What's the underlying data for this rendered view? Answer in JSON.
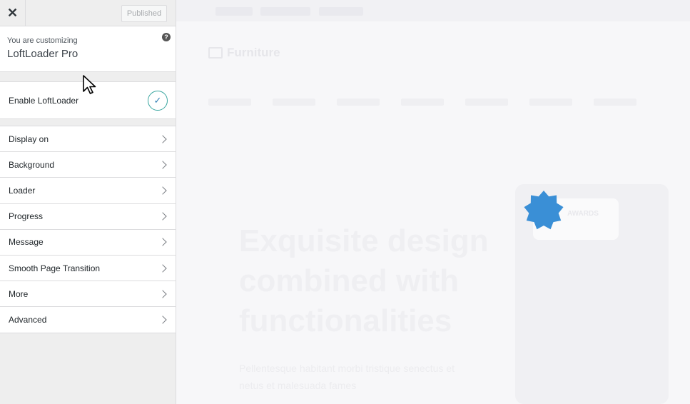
{
  "topbar": {
    "close_symbol": "✕",
    "published_label": "Published"
  },
  "info": {
    "subtitle": "You are customizing",
    "title": "LoftLoader Pro",
    "help_symbol": "?"
  },
  "enable": {
    "label": "Enable LoftLoader",
    "checked": true,
    "check_symbol": "✓"
  },
  "menu": {
    "items": [
      {
        "label": "Display on"
      },
      {
        "label": "Background"
      },
      {
        "label": "Loader"
      },
      {
        "label": "Progress"
      },
      {
        "label": "Message"
      },
      {
        "label": "Smooth Page Transition"
      },
      {
        "label": "More"
      },
      {
        "label": "Advanced"
      }
    ]
  },
  "preview": {
    "brand": "Furniture",
    "heading_line1": "Exquisite design",
    "heading_line2": "combined with",
    "heading_line3": "functionalities",
    "paragraph": "Pellentesque habitant morbi tristique senectus et netus et malesuada fames",
    "badge_text": "AWARDS",
    "loader_color": "#3a8fd6"
  },
  "colors": {
    "accent_teal": "#3aa6a0",
    "check_blue": "#2f7fb5",
    "sidebar_bg": "#eeeeee"
  }
}
